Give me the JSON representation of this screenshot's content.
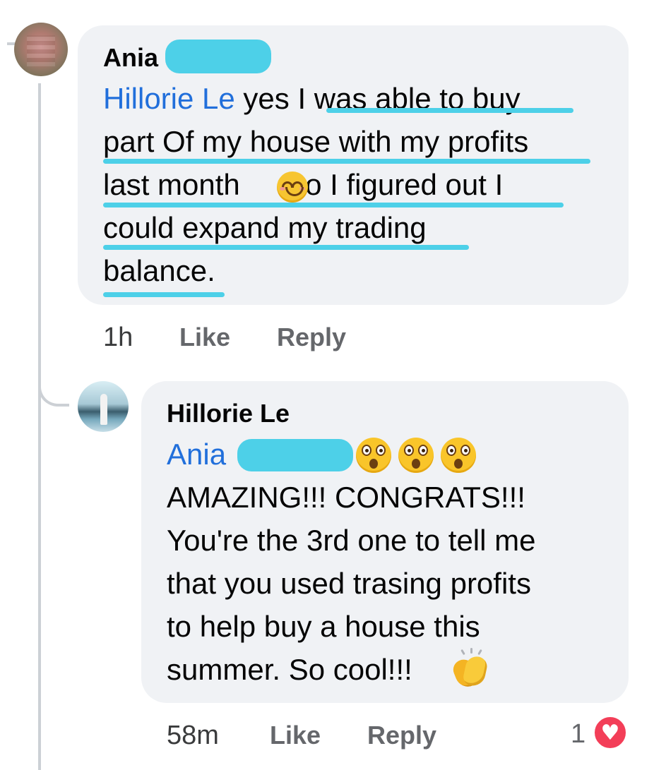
{
  "comment": {
    "author": "Ania",
    "mention": "Hillorie Le",
    "line1_rest": " yes I was able to buy",
    "line2": "part Of my house with my profits",
    "line3_before_emoji": "last month ",
    "line3_after_emoji": " so I figured out I",
    "line4": "could expand my trading",
    "line5": "balance.",
    "time": "1h",
    "like_label": "Like",
    "reply_label": "Reply",
    "emoji": "smiling-face-with-smiling-eyes"
  },
  "reply": {
    "author": "Hillorie Le",
    "mention": "Ania",
    "line2": "AMAZING!!! CONGRATS!!!",
    "line3": "You're the 3rd one to tell me",
    "line4": "that you used trasing profits",
    "line5": "to help buy a house this",
    "line6": "summer. So cool!!!",
    "time": "58m",
    "like_label": "Like",
    "reply_label": "Reply",
    "reaction_count": "1",
    "reaction_type": "heart",
    "emojis": [
      "flushed-face",
      "flushed-face",
      "flushed-face",
      "clapping-hands"
    ]
  },
  "colors": {
    "bubble": "#f0f2f5",
    "mention": "#216fdb",
    "highlight": "#4dd0e8",
    "meta": "#65676b",
    "heart": "#f33e58"
  }
}
